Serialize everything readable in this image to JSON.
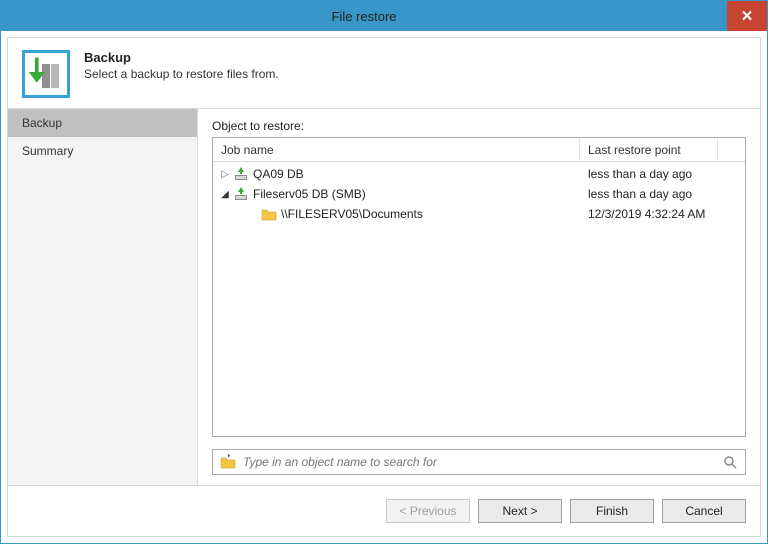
{
  "window": {
    "title": "File restore"
  },
  "header": {
    "heading": "Backup",
    "subheading": "Select a backup to restore files from."
  },
  "nav": {
    "items": [
      {
        "label": "Backup",
        "selected": true
      },
      {
        "label": "Summary",
        "selected": false
      }
    ]
  },
  "main": {
    "label": "Object to restore:",
    "columns": {
      "job_name": "Job name",
      "last_restore_point": "Last restore point"
    },
    "rows": [
      {
        "indent": 0,
        "expander": "▷",
        "icon": "job",
        "label": "QA09 DB",
        "restore": "less than a day ago"
      },
      {
        "indent": 0,
        "expander": "◢",
        "icon": "job",
        "label": "Fileserv05 DB (SMB)",
        "restore": "less than a day ago"
      },
      {
        "indent": 1,
        "expander": "",
        "icon": "folder",
        "label": "\\\\FILESERV05\\Documents",
        "restore": "12/3/2019 4:32:24 AM"
      }
    ],
    "search_placeholder": "Type in an object name to search for"
  },
  "footer": {
    "previous": "< Previous",
    "next": "Next >",
    "finish": "Finish",
    "cancel": "Cancel"
  }
}
